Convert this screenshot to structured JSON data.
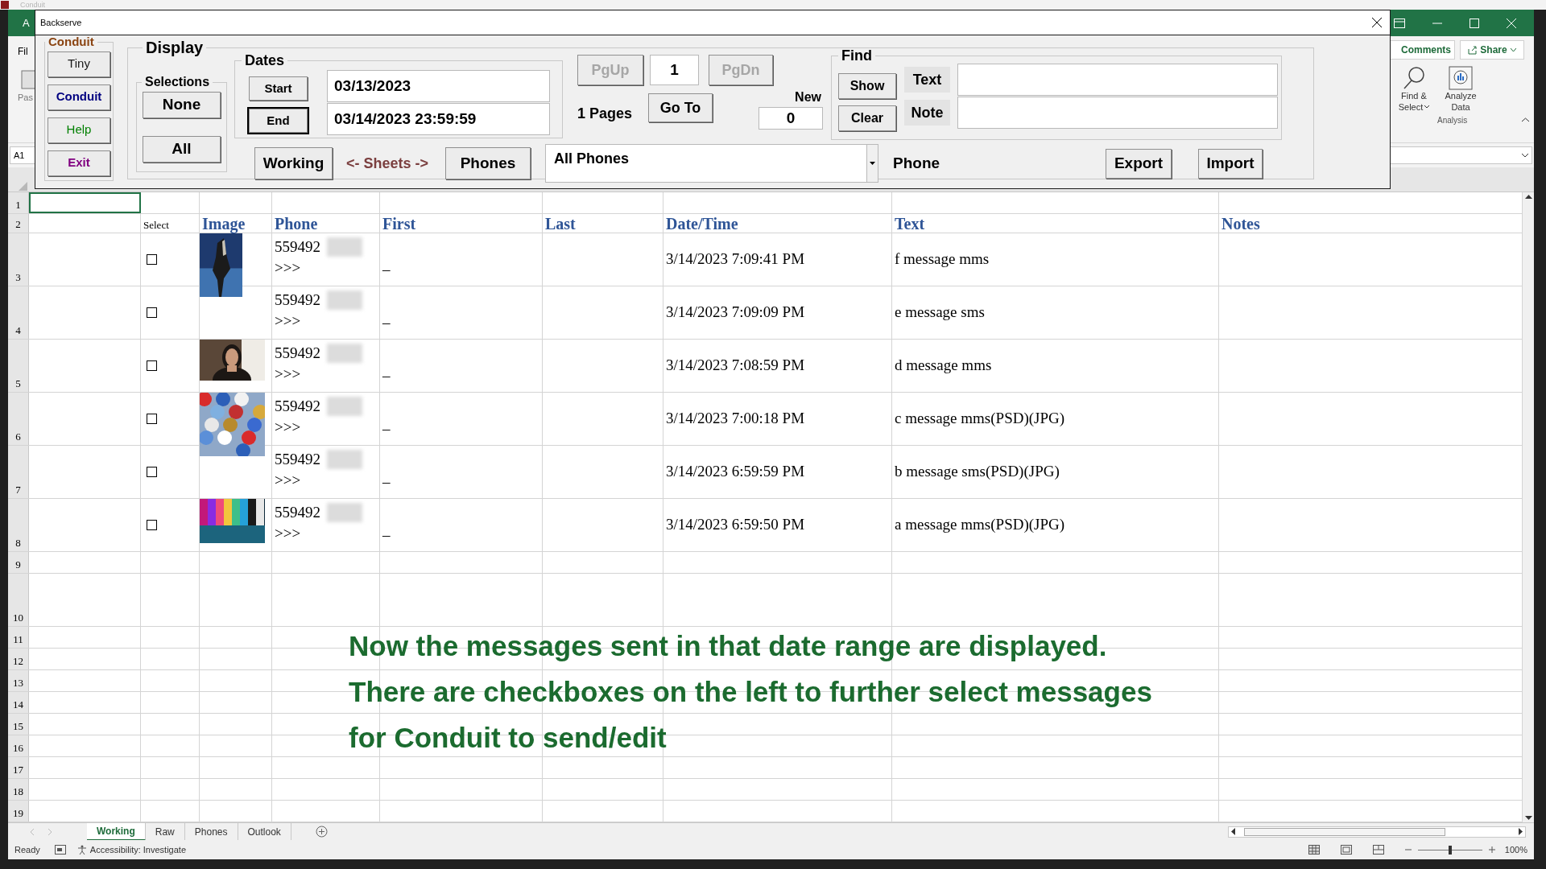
{
  "excel": {
    "title": "Conduit",
    "green_fragment": "A",
    "menu_fragment": "Fil",
    "paste_fragment": "Pas",
    "name_box": "A1",
    "comments": "Comments",
    "share": "Share",
    "find_select": [
      "Find &",
      "Select"
    ],
    "analyze": [
      "Analyze",
      "Data"
    ],
    "group_label": "Analysis"
  },
  "dialog": {
    "title": "Backserve",
    "conduit": {
      "label": "Conduit",
      "buttons": [
        {
          "label": "Tiny",
          "color": "#1a1a1a"
        },
        {
          "label": "Conduit",
          "color": "#000080"
        },
        {
          "label": "Help",
          "color": "#008000"
        },
        {
          "label": "Exit",
          "color": "#800080"
        }
      ]
    },
    "display": {
      "label": "Display",
      "selections": {
        "label": "Selections",
        "buttons": [
          "None",
          "All"
        ]
      },
      "dates": {
        "label": "Dates",
        "buttons": [
          {
            "label": "Start",
            "focused": false
          },
          {
            "label": "End",
            "focused": true
          }
        ],
        "fields": [
          "03/13/2023",
          "03/14/2023 23:59:59"
        ]
      },
      "paging": {
        "prev": {
          "label": "PgUp",
          "disabled": true
        },
        "page": "1",
        "next": {
          "label": "PgDn",
          "disabled": true
        },
        "pages": "1 Pages",
        "go_to": "Go To",
        "new_label": "New",
        "new_value": "0"
      },
      "find": {
        "label": "Find",
        "show": "Show",
        "clear": "Clear",
        "fields": [
          {
            "label": "Text"
          },
          {
            "label": "Note"
          }
        ]
      },
      "sheets": {
        "left": "Working",
        "middle": "<- Sheets ->",
        "right": "Phones"
      },
      "combo": "All Phones",
      "phone_label": "Phone",
      "export": "Export",
      "import": "Import"
    }
  },
  "sheet": {
    "row_numbers": [
      "1",
      "2",
      "3",
      "4",
      "5",
      "6",
      "7",
      "8",
      "9",
      "10",
      "11",
      "12",
      "13",
      "14",
      "15",
      "16",
      "17",
      "18",
      "19"
    ],
    "headers": [
      {
        "label": "Select",
        "kind": "plain"
      },
      {
        "label": "Image",
        "kind": "heading"
      },
      {
        "label": "Phone",
        "kind": "heading"
      },
      {
        "label": "First",
        "kind": "heading"
      },
      {
        "label": "Last",
        "kind": "heading"
      },
      {
        "label": "Date/Time",
        "kind": "heading"
      },
      {
        "label": "Text",
        "kind": "heading"
      },
      {
        "label": "Notes",
        "kind": "heading"
      }
    ],
    "rows": [
      {
        "checked": false,
        "image": true,
        "phone": "559492",
        "more": ">>>",
        "first": "_",
        "date": "3/14/2023 7:09:41 PM",
        "text": "f message mms"
      },
      {
        "checked": false,
        "image": false,
        "phone": "559492",
        "more": ">>>",
        "first": "_",
        "date": "3/14/2023 7:09:09 PM",
        "text": "e message sms"
      },
      {
        "checked": false,
        "image": true,
        "phone": "559492",
        "more": ">>>",
        "first": "_",
        "date": "3/14/2023 7:08:59 PM",
        "text": "d message mms"
      },
      {
        "checked": false,
        "image": true,
        "phone": "559492",
        "more": ">>>",
        "first": "_",
        "date": "3/14/2023 7:00:18 PM",
        "text": "c message mms(PSD)(JPG)"
      },
      {
        "checked": false,
        "image": false,
        "phone": "559492",
        "more": ">>>",
        "first": "_",
        "date": "3/14/2023 6:59:59 PM",
        "text": "b message sms(PSD)(JPG)"
      },
      {
        "checked": false,
        "image": true,
        "phone": "559492",
        "more": ">>>",
        "first": "_",
        "date": "3/14/2023 6:59:50 PM",
        "text": "a message mms(PSD)(JPG)"
      }
    ]
  },
  "annotation": [
    "Now the messages sent in that date range are displayed.",
    "There are checkboxes on the left to further select messages",
    "for Conduit to send/edit"
  ],
  "sheet_tabs": [
    {
      "label": "Working",
      "selected": true
    },
    {
      "label": "Raw",
      "selected": false
    },
    {
      "label": "Phones",
      "selected": false
    },
    {
      "label": "Outlook",
      "selected": false
    }
  ],
  "status_bar": {
    "ready": "Ready",
    "accessibility": "Accessibility: Investigate",
    "zoom": {
      "level": 0.5,
      "reading": "100%"
    }
  }
}
